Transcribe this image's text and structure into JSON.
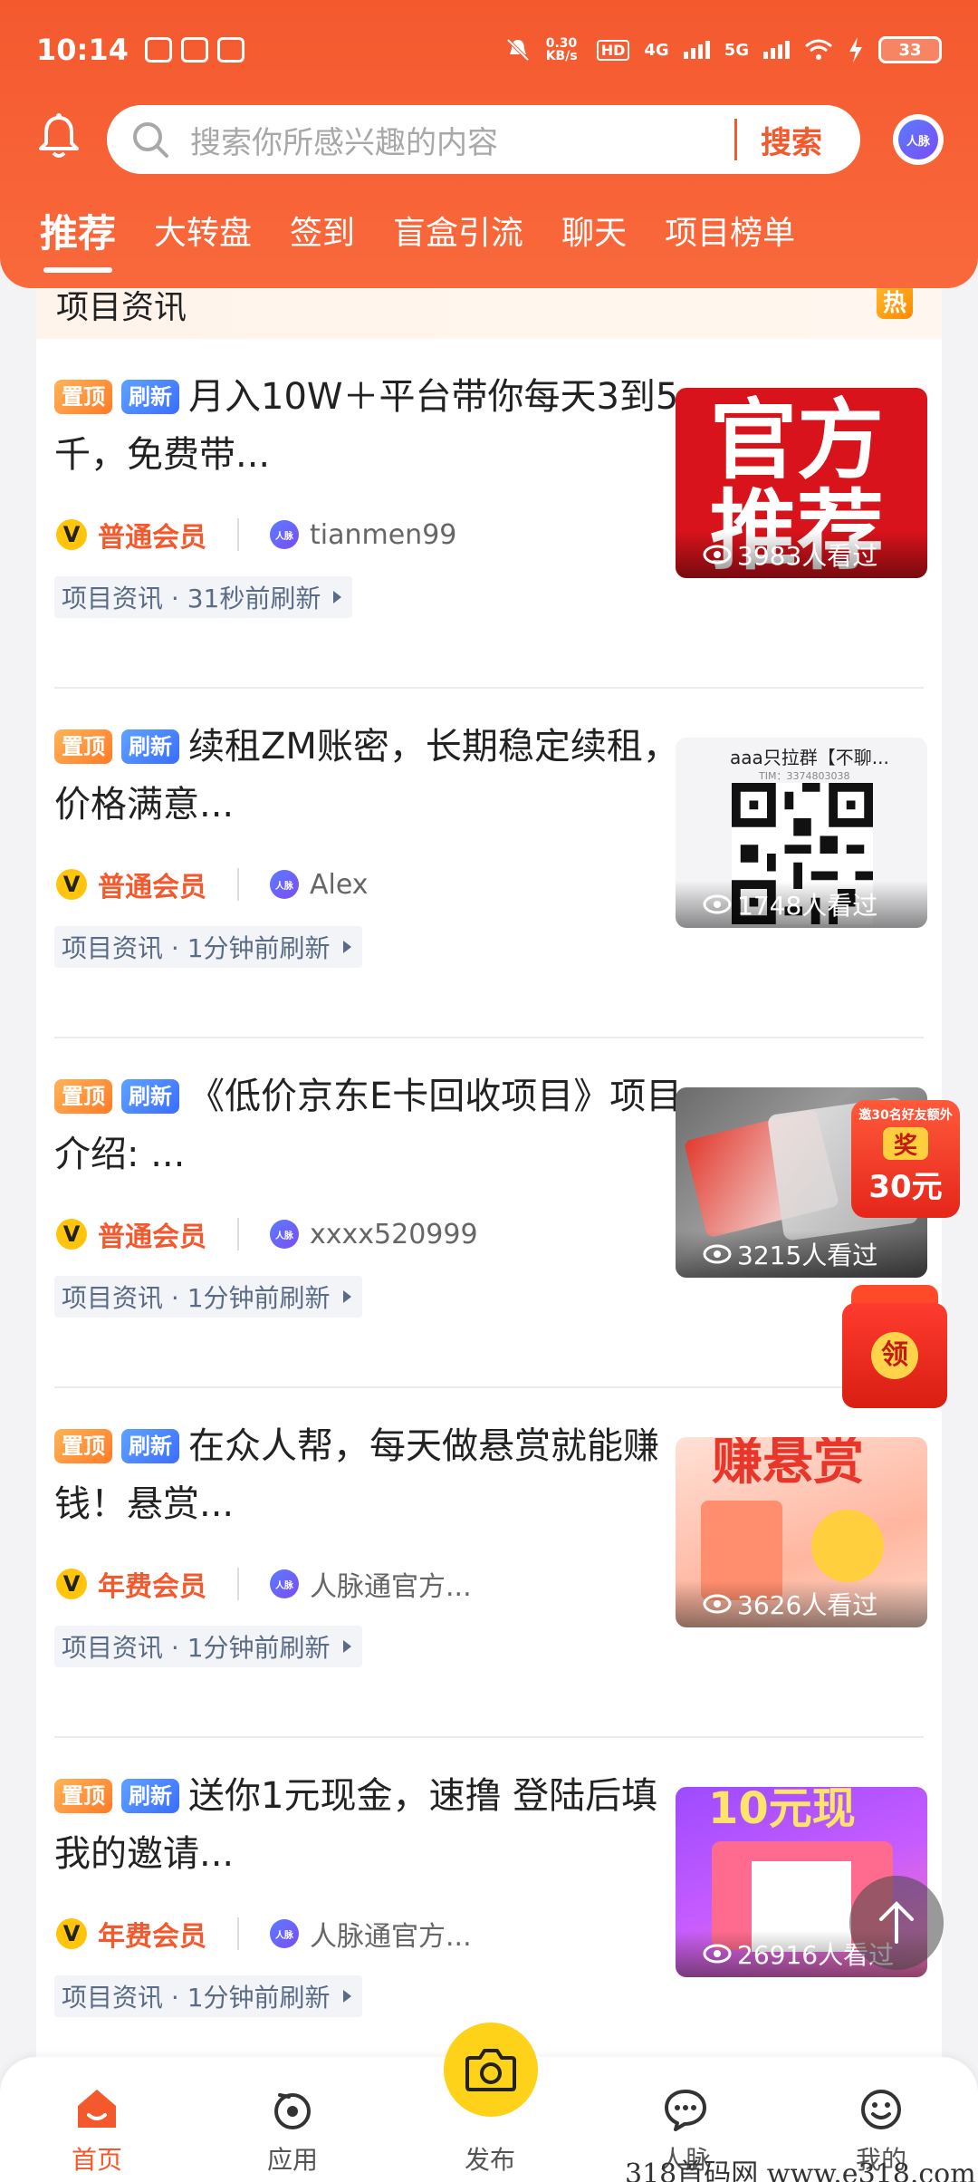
{
  "status_bar": {
    "time": "10:14",
    "speed": "0.30 KB/s",
    "network_1": "4G",
    "network_2": "5G",
    "battery": "33"
  },
  "search": {
    "placeholder": "搜索你所感兴趣的内容",
    "button": "搜索"
  },
  "avatar_text": "人脉",
  "tabs": [
    "推荐",
    "大转盘",
    "签到",
    "盲盒引流",
    "聊天",
    "项目榜单"
  ],
  "section": {
    "title": "项目资讯",
    "hot_badge": "热"
  },
  "badges": {
    "top": "置顶",
    "new": "刷新"
  },
  "posts": [
    {
      "title": "月入10W＋平台带你每天3到5千，免费带...",
      "member": "普通会员",
      "author": "tianmen99",
      "tag": "项目资讯 · 31秒前刷新",
      "views": "3983人看过",
      "thumb_text": [
        "官方",
        "推荐"
      ]
    },
    {
      "title": "续租ZM账密，长期稳定续租，价格满意...",
      "member": "普通会员",
      "author": "Alex",
      "tag": "项目资讯 · 1分钟前刷新",
      "views": "1748人看过",
      "thumb_text": [
        "aaa只拉群【不聊...",
        "TIM：3374803038"
      ]
    },
    {
      "title": "《低价京东E卡回收项目》项目介绍: ...",
      "member": "普通会员",
      "author": "xxxx520999",
      "tag": "项目资讯 · 1分钟前刷新",
      "views": "3215人看过",
      "thumb_text": []
    },
    {
      "title": "在众人帮，每天做悬赏就能赚钱！悬赏...",
      "member": "年费会员",
      "author": "人脉通官方...",
      "tag": "项目资讯 · 1分钟前刷新",
      "views": "3626人看过",
      "thumb_text": [
        "赚悬赏"
      ]
    },
    {
      "title": "送你1元现金，速撸 登陆后填我的邀请...",
      "member": "年费会员",
      "author": "人脉通官方...",
      "tag": "项目资讯 · 1分钟前刷新",
      "views": "26916人看过",
      "thumb_text": [
        "10元现"
      ]
    }
  ],
  "floating": {
    "bonus_line1": "邀30名好友额外",
    "bonus_line2": "奖",
    "bonus_amount": "30元",
    "redpack": "领"
  },
  "bottom_nav": [
    "首页",
    "应用",
    "发布",
    "人脉",
    "我的"
  ],
  "watermark": "318首码网 www.e318.com",
  "colors": {
    "brand": "#f4592e",
    "publish": "#ffd21a",
    "vip": "#ffc40c"
  }
}
